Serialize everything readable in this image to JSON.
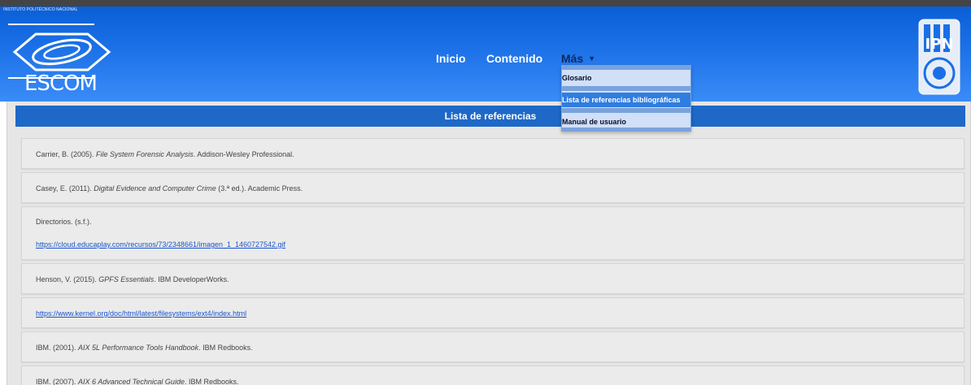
{
  "header": {
    "escom_small_text": "INSTITUTO POLITÉCNICO NACIONAL",
    "escom_wordmark": "ESCOM",
    "ipn_logo_text": "IPN"
  },
  "nav": {
    "inicio": "Inicio",
    "contenido": "Contenido",
    "mas": "Más"
  },
  "dropdown": {
    "items": [
      {
        "label": "Glosario"
      },
      {
        "label": "Lista de referencias bibliográficas"
      },
      {
        "label": "Manual de usuario"
      }
    ],
    "selected_index": 1
  },
  "page_title": "Lista de referencias",
  "references": [
    {
      "author": "Carrier, B. (2005). ",
      "title": "File System Forensic Analysis",
      "rest": ". Addison-Wesley Professional."
    },
    {
      "author": "Casey, E. (2011). ",
      "title": "Digital Evidence and Computer Crime",
      "rest": " (3.ª ed.). Academic Press."
    },
    {
      "author": "Directorios. (s.f.).",
      "link": "https://cloud.educaplay.com/recursos/73/2348661/imagen_1_1460727542.gif"
    },
    {
      "author": "Henson, V. (2015). ",
      "title": "GPFS Essentials",
      "rest": ". IBM DeveloperWorks."
    },
    {
      "link": "https://www.kernel.org/doc/html/latest/filesystems/ext4/index.html"
    },
    {
      "author": "IBM. (2001). ",
      "title": "AIX 5L Performance Tools Handbook",
      "rest": ". IBM Redbooks."
    },
    {
      "author": "IBM. (2007). ",
      "title": "AIX 6 Advanced Technical Guide",
      "rest": ". IBM Redbooks."
    }
  ],
  "colors": {
    "header_blue": "#1a6fe6",
    "title_bar_blue": "#1e68c8",
    "dropdown_selected": "#2f7de0",
    "link_blue": "#1a55cc"
  }
}
